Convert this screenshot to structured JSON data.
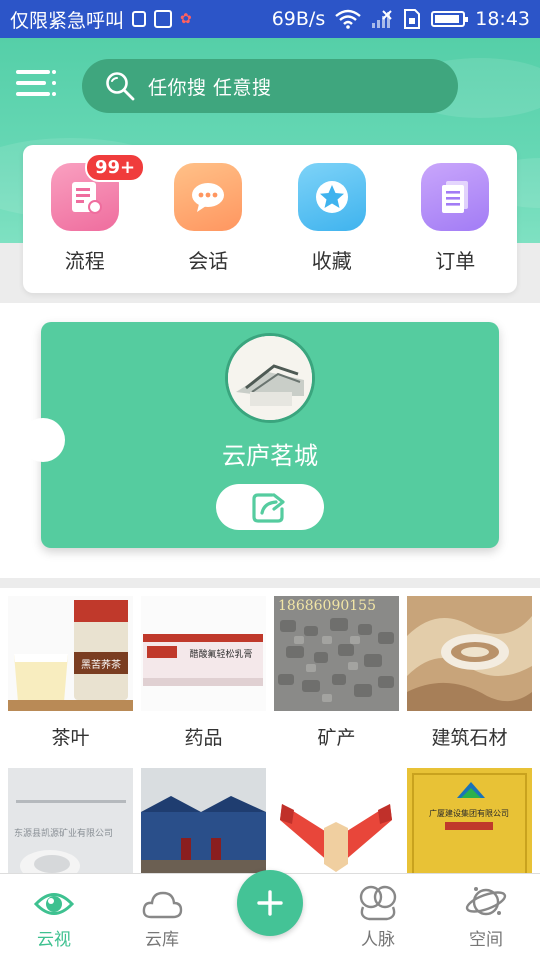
{
  "status_bar": {
    "carrier": "仅限紧急呼叫",
    "speed": "69B/s",
    "time": "18:43"
  },
  "header": {
    "search_placeholder": "任你搜  任意搜"
  },
  "quick_actions": [
    {
      "label": "流程",
      "badge": "99+",
      "icon": "document-icon",
      "color_from": "#f9a0c0",
      "color_to": "#ef6d9e"
    },
    {
      "label": "会话",
      "icon": "chat-bubble-icon",
      "color_from": "#ffc188",
      "color_to": "#ff9660"
    },
    {
      "label": "收藏",
      "icon": "star-icon",
      "color_from": "#7ed3f8",
      "color_to": "#3fb3ee"
    },
    {
      "label": "订单",
      "icon": "list-doc-icon",
      "color_from": "#c9a6fb",
      "color_to": "#a27cf5"
    }
  ],
  "card": {
    "title": "云庐茗城"
  },
  "categories": [
    {
      "label": "茶叶",
      "image_text": "黑苦荞茶"
    },
    {
      "label": "药品",
      "image_text": "醋酸氟轻松乳膏"
    },
    {
      "label": "矿产",
      "image_text": "18686090155"
    },
    {
      "label": "建筑石材",
      "image_text": ""
    },
    {
      "label": "",
      "image_text": "东源县凯源矿业有限公司"
    },
    {
      "label": "",
      "image_text": ""
    },
    {
      "label": "",
      "image_text": ""
    },
    {
      "label": "",
      "image_text": "广厦建设集团有限公司"
    }
  ],
  "bottom_nav": [
    {
      "label": "云视",
      "icon": "eye-icon",
      "active": true
    },
    {
      "label": "云库",
      "icon": "cloud-icon",
      "active": false
    },
    {
      "label": "人脉",
      "icon": "contacts-icon",
      "active": false
    },
    {
      "label": "空间",
      "icon": "planet-icon",
      "active": false
    }
  ],
  "colors": {
    "primary": "#55cc9f",
    "status_bar": "#2c55c8",
    "badge": "#f03c3c"
  }
}
